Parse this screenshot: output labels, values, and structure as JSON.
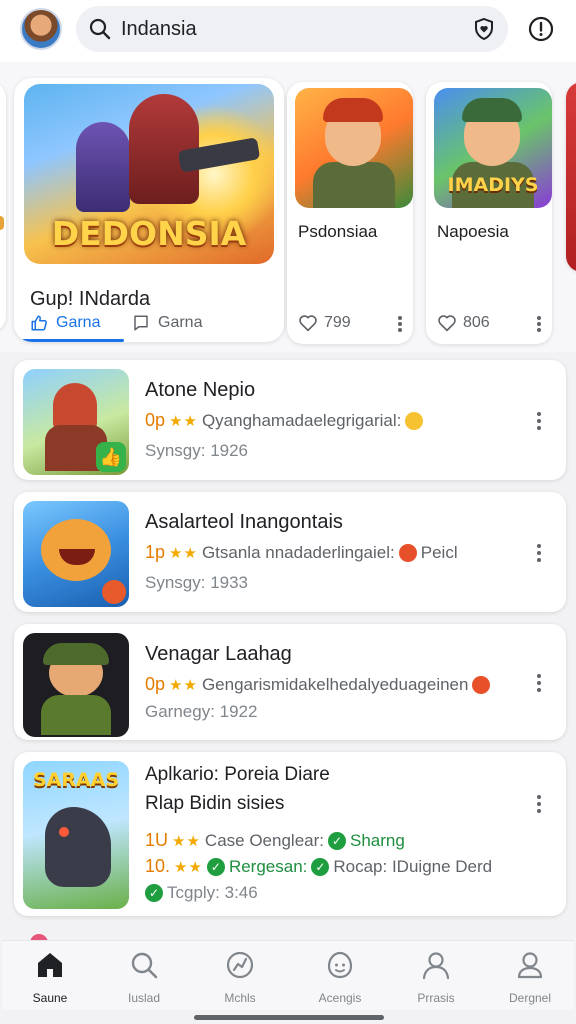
{
  "header": {
    "search_query": "Indansia",
    "icons": [
      "avatar",
      "search-icon",
      "shield-heart-icon",
      "alert-icon"
    ]
  },
  "featured": {
    "main": {
      "art_logo": "DEDONSIA",
      "title": "Gup! INdarda",
      "action_primary": "Garna",
      "action_secondary": "Garna"
    },
    "cards": [
      {
        "title": "Psdonsiaa",
        "likes": "799"
      },
      {
        "title": "Napoesia",
        "logo": "IMADIYS",
        "likes": "806"
      }
    ]
  },
  "list": [
    {
      "title": "Atone Nepio",
      "rank": "0p",
      "stars": "★★",
      "desc": "Qyanghamadaelegrigarial:",
      "sub": "Synsgy: 1926"
    },
    {
      "title": "Asalarteol Inangontais",
      "rank": "1p",
      "stars": "★★",
      "desc": "Gtsanla nnadaderlingaiel:",
      "desc_tail": "Peicl",
      "sub": "Synsgy: 1933"
    },
    {
      "title": "Venagar Laahag",
      "rank": "0p",
      "stars": "★★",
      "desc": "Gengarismidakelhedalyeduageinen",
      "sub": "Garnegy: 1922"
    },
    {
      "title": "Aplkario: Poreia Diare",
      "title2": "Rlap Bidin sisies",
      "thumb_logo": "SARAAS",
      "line1_rank": "1U",
      "line1_stars": "★★",
      "line1_text": "Case Oenglear:",
      "line1_green": "Sharng",
      "line2_rank": "10.",
      "line2_stars": "★★",
      "line2_green": "Rergesan:",
      "line2_text": "Rocap: IDuigne Derd",
      "line3_text": "Tcgply: 3:46"
    }
  ],
  "bottom_nav": [
    {
      "label": "Saune",
      "icon": "home-icon",
      "active": true
    },
    {
      "label": "Iuslad",
      "icon": "search-icon",
      "active": false
    },
    {
      "label": "Mchls",
      "icon": "gauge-icon",
      "active": false
    },
    {
      "label": "Acengis",
      "icon": "face-icon",
      "active": false
    },
    {
      "label": "Prrasis",
      "icon": "person-icon",
      "active": false
    },
    {
      "label": "Dergnel",
      "icon": "account-icon",
      "active": false
    }
  ],
  "colors": {
    "accent": "#1a73e8",
    "rank": "#e67c00",
    "star": "#f2a900",
    "green": "#1e8e3e"
  }
}
